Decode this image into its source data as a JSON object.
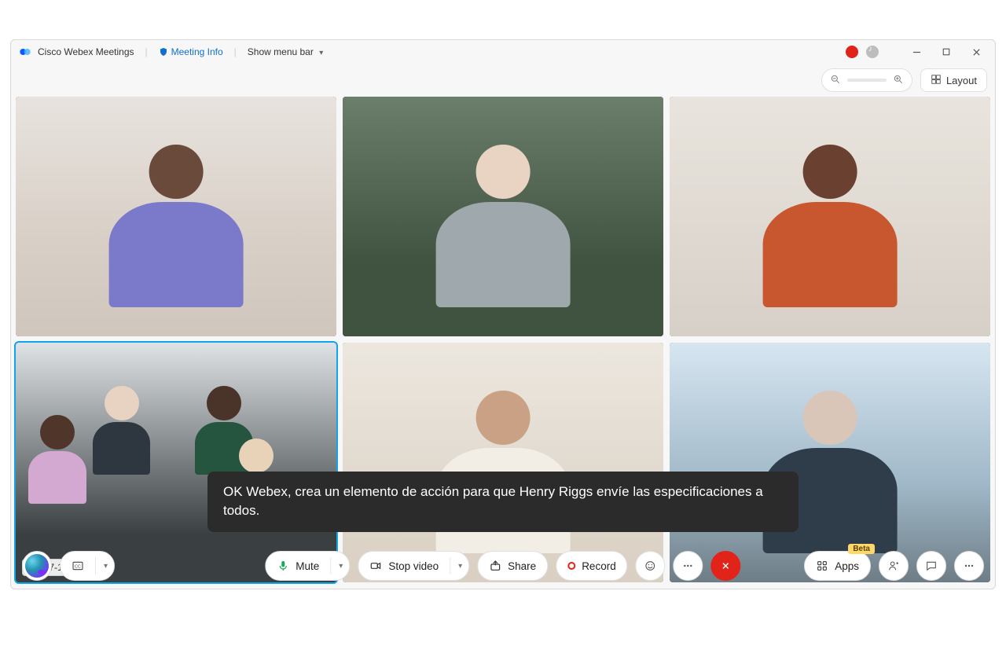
{
  "titlebar": {
    "app_name": "Cisco Webex Meetings",
    "meeting_info": "Meeting Info",
    "menu_bar": "Show menu bar"
  },
  "topright": {
    "layout": "Layout"
  },
  "participants": [
    {
      "label": ""
    },
    {
      "label": ""
    },
    {
      "label": ""
    },
    {
      "label": "SHN7-16-GREA",
      "active": true
    },
    {
      "label": ""
    },
    {
      "label": ""
    }
  ],
  "caption_text": "OK Webex, crea un elemento de acción para que Henry Riggs envíe las especificaciones a todos.",
  "toolbar": {
    "mute": "Mute",
    "stop_video": "Stop video",
    "share": "Share",
    "record": "Record",
    "apps": "Apps",
    "apps_badge": "Beta"
  }
}
